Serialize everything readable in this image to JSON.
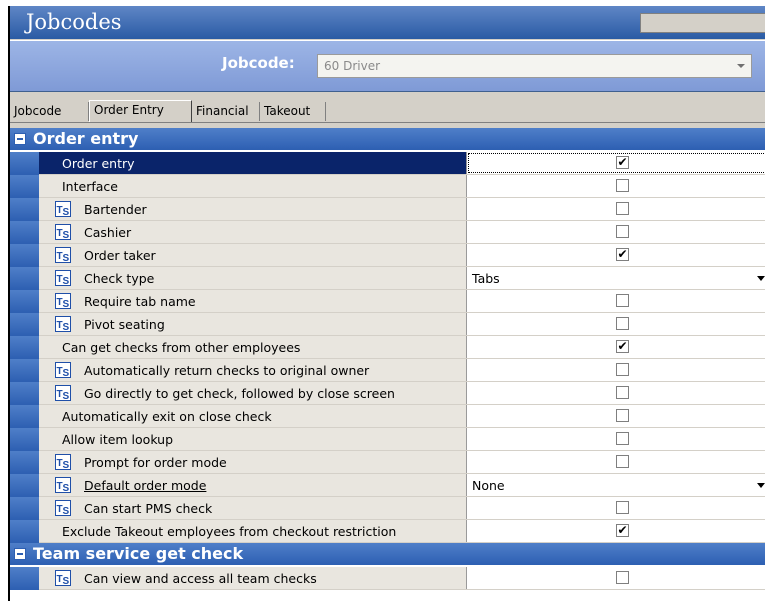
{
  "window": {
    "title": "Jobcodes"
  },
  "selector": {
    "label": "Jobcode:",
    "value": "60 Driver"
  },
  "tabs": [
    {
      "label": "Jobcode",
      "active": false
    },
    {
      "label": "Order Entry",
      "active": true
    },
    {
      "label": "Financial",
      "active": false
    },
    {
      "label": "Takeout",
      "active": false
    }
  ],
  "sections": [
    {
      "title": "Order entry",
      "expanded": true,
      "rows": [
        {
          "label": "Order entry",
          "ts": false,
          "type": "checkbox",
          "checked": true,
          "selected": true
        },
        {
          "label": "Interface",
          "ts": false,
          "type": "checkbox",
          "checked": false
        },
        {
          "label": "Bartender",
          "ts": true,
          "type": "checkbox",
          "checked": false
        },
        {
          "label": "Cashier",
          "ts": true,
          "type": "checkbox",
          "checked": false
        },
        {
          "label": "Order taker",
          "ts": true,
          "type": "checkbox",
          "checked": true
        },
        {
          "label": "Check type",
          "ts": true,
          "type": "dropdown",
          "value": "Tabs"
        },
        {
          "label": "Require tab name",
          "ts": true,
          "type": "checkbox",
          "checked": false
        },
        {
          "label": "Pivot seating",
          "ts": true,
          "type": "checkbox",
          "checked": false
        },
        {
          "label": "Can get checks from other employees",
          "ts": false,
          "type": "checkbox",
          "checked": true
        },
        {
          "label": "Automatically return checks to original owner",
          "ts": true,
          "type": "checkbox",
          "checked": false
        },
        {
          "label": "Go directly to get check, followed by close screen",
          "ts": true,
          "type": "checkbox",
          "checked": false
        },
        {
          "label": "Automatically exit on close check",
          "ts": false,
          "type": "checkbox",
          "checked": false
        },
        {
          "label": "Allow item lookup",
          "ts": false,
          "type": "checkbox",
          "checked": false
        },
        {
          "label": "Prompt for order mode",
          "ts": true,
          "type": "checkbox",
          "checked": false
        },
        {
          "label": "Default order mode",
          "ts": true,
          "type": "dropdown",
          "value": "None",
          "underline": true
        },
        {
          "label": "Can start PMS check",
          "ts": true,
          "type": "checkbox",
          "checked": false
        },
        {
          "label": "Exclude Takeout employees from checkout restriction",
          "ts": false,
          "type": "checkbox",
          "checked": true
        }
      ]
    },
    {
      "title": "Team service get check",
      "expanded": true,
      "rows": [
        {
          "label": "Can view and access all team checks",
          "ts": true,
          "type": "checkbox",
          "checked": false
        }
      ]
    }
  ],
  "icons": {
    "ts_icon": "ts-icon",
    "checkmark": "✔"
  },
  "colors": {
    "header_blue": "#2d5fb2",
    "selection": "#0a246a",
    "name_cell_bg": "#e9e6df"
  }
}
